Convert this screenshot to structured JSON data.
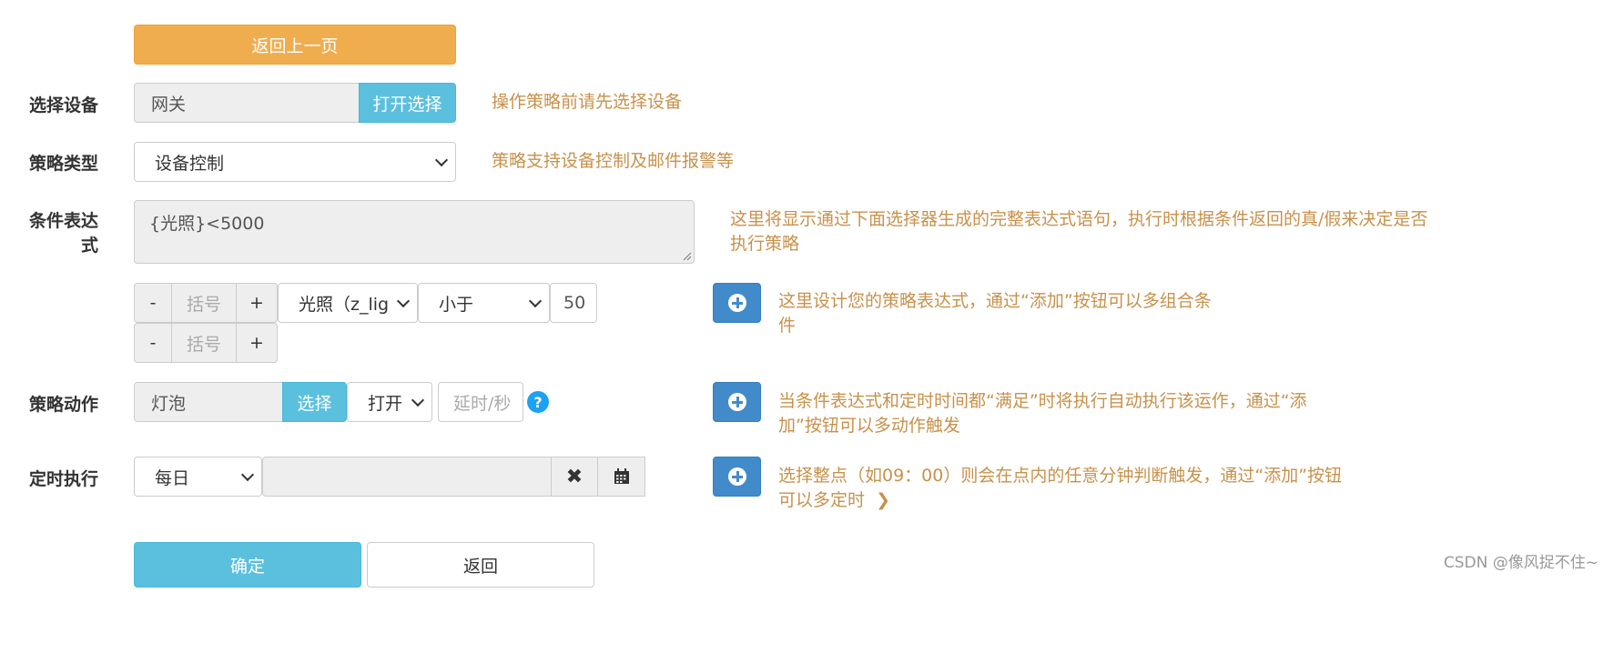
{
  "back_top_label": "返回上一页",
  "device": {
    "label": "选择设备",
    "value": "网关",
    "open_button": "打开选择",
    "hint": "操作策略前请先选择设备"
  },
  "strategy_type": {
    "label": "策略类型",
    "selected": "设备控制",
    "hint": "策略支持设备控制及邮件报警等"
  },
  "condition": {
    "label_line1": "条件表达",
    "label_line2": "式",
    "expression": "{光照}<5000",
    "hint_line1": "这里将显示通过下面选择器生成的完整表达式语句，执行时根据条件返回的真/假来决定是否",
    "hint_line2": "执行策略"
  },
  "builder": {
    "minus": "-",
    "plus": "+",
    "bracket_placeholder": "括号",
    "sensor_selected": "光照（z_lig",
    "operator_selected": "小于",
    "value": "50",
    "hint_line1": "这里设计您的策略表达式，通过“添加”按钮可以多组合条",
    "hint_line2": "件"
  },
  "action": {
    "label": "策略动作",
    "device_value": "灯泡",
    "select_button": "选择",
    "state_selected": "打开",
    "delay_placeholder": "延时/秒",
    "help_symbol": "?",
    "hint_line1": "当条件表达式和定时时间都“满足”时将执行自动执行该运作，通过“添",
    "hint_line2": "加”按钮可以多动作触发"
  },
  "schedule": {
    "label": "定时执行",
    "frequency_selected": "每日",
    "time_value": "",
    "clear_symbol": "✖",
    "hint_line1": "选择整点（如09：00）则会在点内的任意分钟判断触发，通过“添加”按钮",
    "hint_line2": "可以多定时",
    "hint_arrow": "❯"
  },
  "footer": {
    "confirm_label": "确定",
    "back_label": "返回"
  },
  "watermark": "CSDN @像风捉不住~",
  "icons": {
    "add": "plus-circle-icon",
    "help": "question-circle-icon",
    "clear": "times-icon",
    "calendar": "calendar-icon"
  },
  "colors": {
    "primary_orange": "#f0ad4e",
    "info_blue": "#5bc0de",
    "primary_blue": "#428bca",
    "hint_text": "#c8914b",
    "help_icon": "#1da1f2"
  }
}
